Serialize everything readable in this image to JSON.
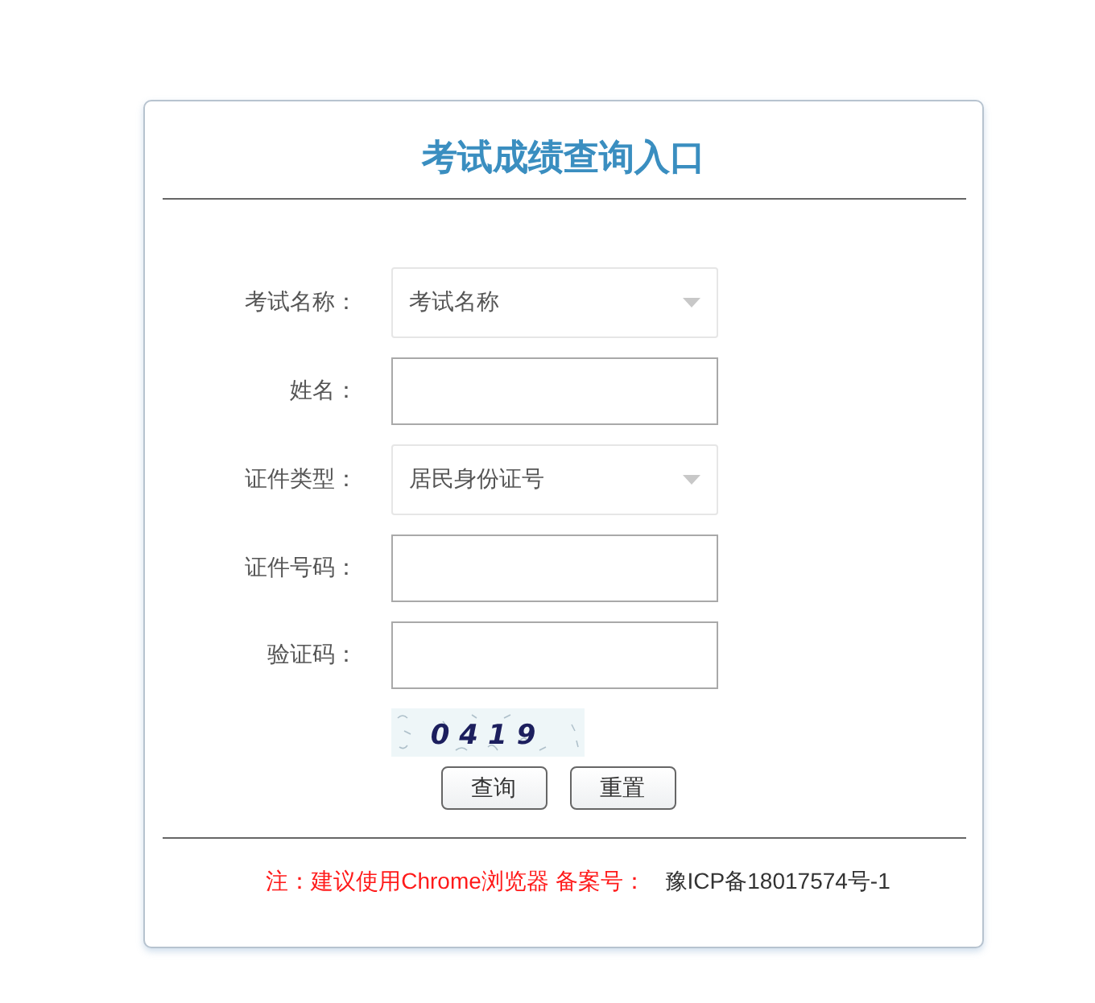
{
  "title": "考试成绩查询入口",
  "form": {
    "fields": [
      {
        "kind": "select",
        "label": "考试名称：",
        "value": "考试名称"
      },
      {
        "kind": "text",
        "label": "姓名："
      },
      {
        "kind": "select",
        "label": "证件类型：",
        "value": "居民身份证号"
      },
      {
        "kind": "text",
        "label": "证件号码："
      },
      {
        "kind": "text",
        "label": "验证码："
      }
    ]
  },
  "captcha": {
    "text": "0419"
  },
  "buttons": [
    {
      "label": "查询"
    },
    {
      "label": "重置"
    }
  ],
  "footer": {
    "note": "注：建议使用Chrome浏览器 备案号：",
    "icp": "豫ICP备18017574号-1"
  }
}
